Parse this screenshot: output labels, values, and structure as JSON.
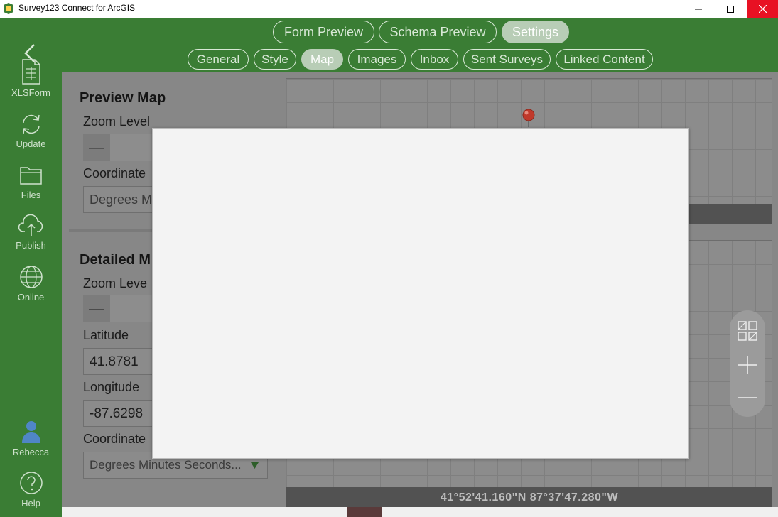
{
  "window": {
    "title": "Survey123 Connect for ArcGIS",
    "close_color": "#e81123"
  },
  "sidebar": {
    "back_icon": "back-chevron-icon",
    "items": [
      {
        "label": "XLSForm",
        "icon": "spreadsheet-icon"
      },
      {
        "label": "Update",
        "icon": "refresh-icon"
      },
      {
        "label": "Files",
        "icon": "folder-icon"
      },
      {
        "label": "Publish",
        "icon": "cloud-upload-icon"
      },
      {
        "label": "Online",
        "icon": "globe-icon"
      }
    ],
    "user": {
      "label": "Rebecca",
      "icon": "user-icon",
      "color": "#4f86c6"
    },
    "help": {
      "label": "Help",
      "icon": "help-icon"
    }
  },
  "top_tabs": {
    "items": [
      {
        "label": "Form Preview"
      },
      {
        "label": "Schema Preview"
      },
      {
        "label": "Settings",
        "active": true
      }
    ]
  },
  "sub_tabs": {
    "items": [
      {
        "label": "General"
      },
      {
        "label": "Style"
      },
      {
        "label": "Map",
        "active": true
      },
      {
        "label": "Images"
      },
      {
        "label": "Inbox"
      },
      {
        "label": "Sent Surveys"
      },
      {
        "label": "Linked Content"
      }
    ]
  },
  "preview_map": {
    "title": "Preview Map",
    "zoom_label": "Zoom Level",
    "zoom_minus": "—",
    "coord_label": "Coordinate",
    "coord_value": "Degrees M"
  },
  "detailed_map": {
    "title": "Detailed M",
    "zoom_label": "Zoom Leve",
    "zoom_minus": "—",
    "lat_label": "Latitude",
    "lat_value": "41.8781",
    "lon_label": "Longitude",
    "lon_value": "-87.6298",
    "coord_label": "Coordinate",
    "coord_value": "Degrees Minutes Seconds...",
    "coord_dropdown_icon": "dropdown-triangle-icon"
  },
  "map_footer": {
    "coordinates": "41°52'41.160\"N 87°37'47.280\"W"
  },
  "map_tools": [
    "basemap-grid-icon",
    "zoom-in-icon",
    "zoom-out-icon"
  ],
  "colors": {
    "brand_green": "#3a7d34",
    "modal_bg": "#f3f3f3",
    "pin_red": "#c0392b"
  }
}
